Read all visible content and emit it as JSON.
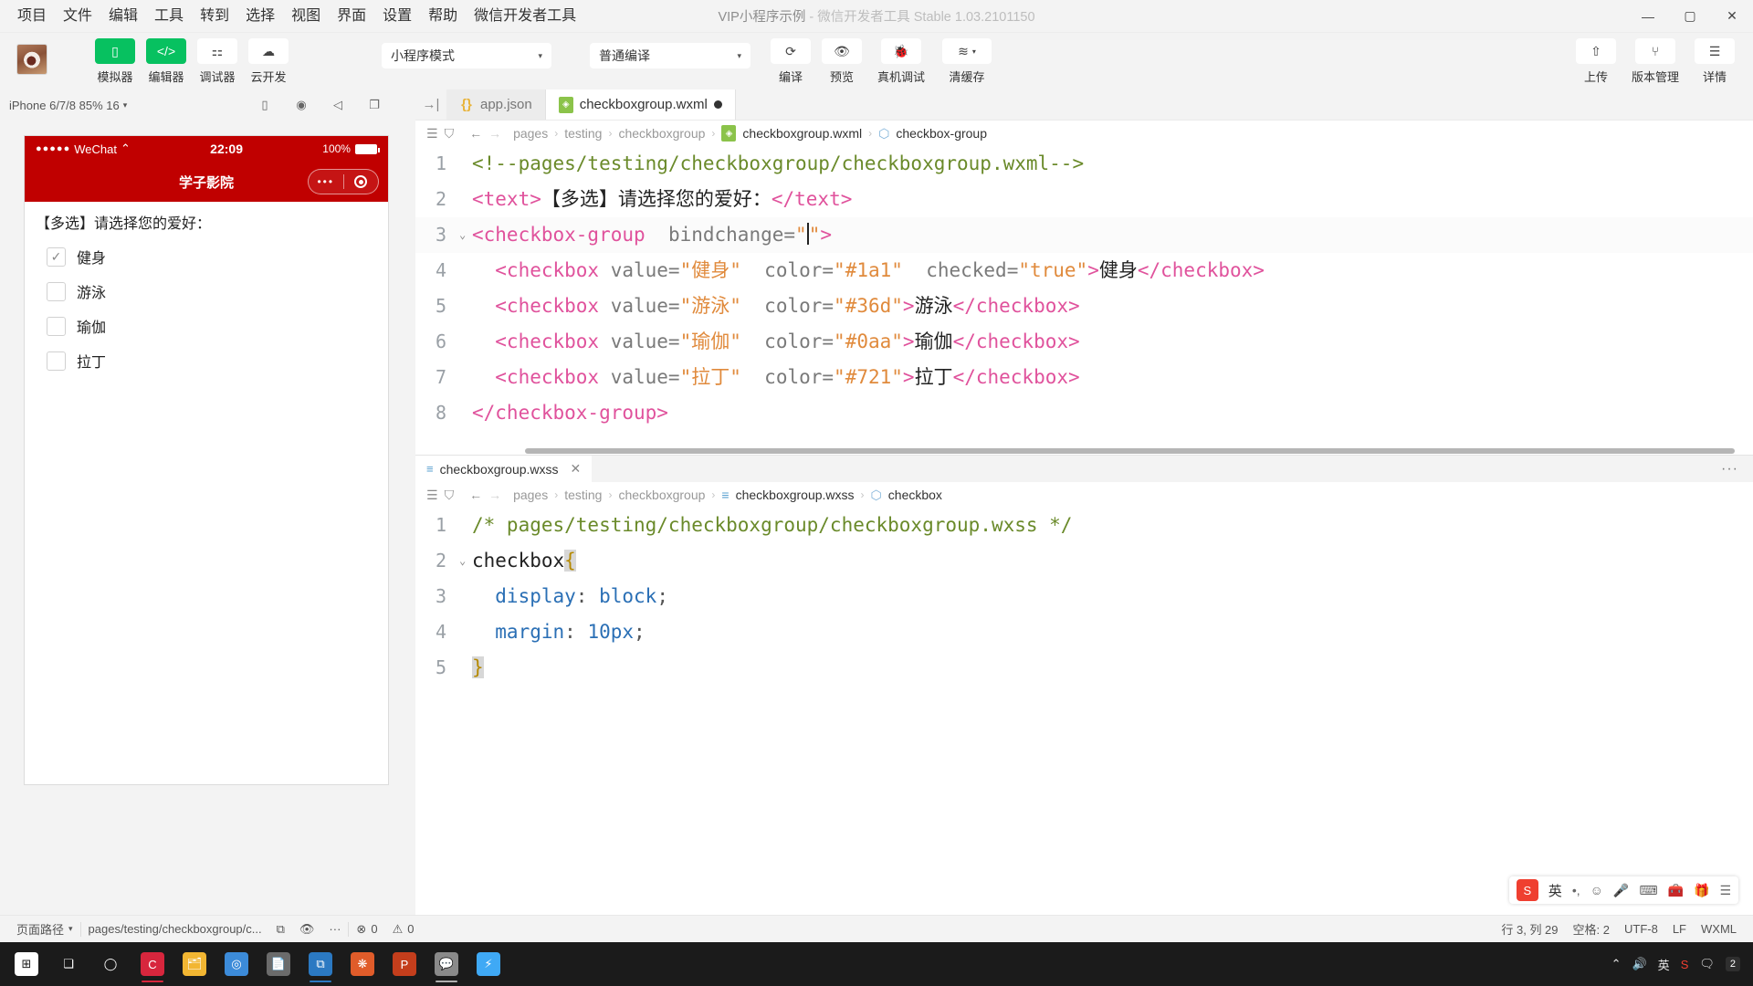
{
  "window": {
    "title_main": "VIP小程序示例",
    "title_sep": " - ",
    "title_sub": "微信开发者工具 Stable 1.03.2101150",
    "minimize": "—",
    "maximize": "▢",
    "close": "✕"
  },
  "menubar": {
    "items": [
      {
        "label": "项目"
      },
      {
        "label": "文件"
      },
      {
        "label": "编辑"
      },
      {
        "label": "工具"
      },
      {
        "label": "转到"
      },
      {
        "label": "选择"
      },
      {
        "label": "视图"
      },
      {
        "label": "界面"
      },
      {
        "label": "设置"
      },
      {
        "label": "帮助"
      },
      {
        "label": "微信开发者工具"
      }
    ]
  },
  "toolbar": {
    "panels": [
      {
        "label": "模拟器",
        "icon": "phone-icon",
        "glyph": "▯",
        "active": true
      },
      {
        "label": "编辑器",
        "icon": "code-icon",
        "glyph": "</>",
        "active": true
      },
      {
        "label": "调试器",
        "icon": "sliders-icon",
        "glyph": "⚏",
        "active": false
      },
      {
        "label": "云开发",
        "icon": "cloud-icon",
        "glyph": "☁",
        "active": false
      }
    ],
    "mode_select": {
      "value": "小程序模式",
      "caret": "▾"
    },
    "compile_select": {
      "value": "普通编译",
      "caret": "▾"
    },
    "actions": [
      {
        "label": "编译",
        "icon": "refresh-icon",
        "glyph": "⟳"
      },
      {
        "label": "预览",
        "icon": "eye-icon",
        "glyph": "👁"
      },
      {
        "label": "真机调试",
        "icon": "bug-icon",
        "glyph": "🐞"
      },
      {
        "label": "清缓存",
        "icon": "layers-icon",
        "glyph": "≋",
        "caret": "▾"
      }
    ],
    "right_actions": [
      {
        "label": "上传",
        "icon": "upload-icon",
        "glyph": "⇧"
      },
      {
        "label": "版本管理",
        "icon": "branch-icon",
        "glyph": "⑂"
      },
      {
        "label": "详情",
        "icon": "menu-icon",
        "glyph": "☰"
      }
    ]
  },
  "simulator": {
    "device_label": "iPhone 6/7/8 85% 16",
    "device_caret": "▾",
    "header_icons": [
      {
        "name": "device-frame-icon",
        "glyph": "▯"
      },
      {
        "name": "record-icon",
        "glyph": "◉"
      },
      {
        "name": "volume-icon",
        "glyph": "◁"
      },
      {
        "name": "window-icon",
        "glyph": "❐"
      }
    ],
    "phone": {
      "status": {
        "carrier_dots": "●●●●●",
        "carrier": "WeChat",
        "wifi": "⌃",
        "time": "22:09",
        "battery_pct": "100%"
      },
      "nav_title": "学子影院",
      "capsule_dots": "•••",
      "content_title": "【多选】请选择您的爱好：",
      "checkboxes": [
        {
          "label": "健身",
          "checked": true,
          "check_glyph": "✓"
        },
        {
          "label": "游泳",
          "checked": false,
          "check_glyph": ""
        },
        {
          "label": "瑜伽",
          "checked": false,
          "check_glyph": ""
        },
        {
          "label": "拉丁",
          "checked": false,
          "check_glyph": ""
        }
      ]
    }
  },
  "editor": {
    "tab_left_icon": "→|",
    "tabs": [
      {
        "label": "app.json",
        "icon": "json-file-icon",
        "icon_glyph": "{}",
        "active": false,
        "dirty": false
      },
      {
        "label": "checkboxgroup.wxml",
        "icon": "wxml-file-icon",
        "icon_glyph": "◈",
        "active": true,
        "dirty": true
      }
    ],
    "breadcrumb_top": {
      "icons": [
        {
          "name": "outline-icon",
          "glyph": "☰"
        },
        {
          "name": "bookmark-icon",
          "glyph": "⛉"
        },
        {
          "name": "back-arrow-icon",
          "glyph": "←"
        },
        {
          "name": "forward-arrow-icon",
          "glyph": "→"
        }
      ],
      "parts": [
        "pages",
        "testing",
        "checkboxgroup"
      ],
      "file": "checkboxgroup.wxml",
      "symbol": "checkbox-group",
      "separator": "›"
    },
    "wxml_lines": [
      {
        "n": 1,
        "fold": "",
        "tokens": [
          {
            "c": "t-comment",
            "t": "<!--pages/testing/checkboxgroup/checkboxgroup.wxml-->"
          }
        ]
      },
      {
        "n": 2,
        "fold": "",
        "tokens": [
          {
            "c": "t-tag",
            "t": "<text>"
          },
          {
            "c": "t-text",
            "t": "【多选】请选择您的爱好："
          },
          {
            "c": "t-tag",
            "t": "</text>"
          }
        ]
      },
      {
        "n": 3,
        "fold": "⌄",
        "highlight": true,
        "tokens": [
          {
            "c": "t-tag",
            "t": "<checkbox-group"
          },
          {
            "c": "t-attr",
            "t": "  bindchange="
          },
          {
            "c": "t-str",
            "t": "\""
          },
          {
            "c": "cursor",
            "t": ""
          },
          {
            "c": "t-str",
            "t": "\""
          },
          {
            "c": "t-tag",
            "t": ">"
          }
        ]
      },
      {
        "n": 4,
        "fold": "",
        "tokens": [
          {
            "c": "t-tag",
            "t": "  <checkbox"
          },
          {
            "c": "t-attr",
            "t": " value="
          },
          {
            "c": "t-str",
            "t": "\"健身\""
          },
          {
            "c": "t-attr",
            "t": "  color="
          },
          {
            "c": "t-str",
            "t": "\"#1a1\""
          },
          {
            "c": "t-attr",
            "t": "  checked="
          },
          {
            "c": "t-str",
            "t": "\"true\""
          },
          {
            "c": "t-tag",
            "t": ">"
          },
          {
            "c": "t-text",
            "t": "健身"
          },
          {
            "c": "t-tag",
            "t": "</checkbox>"
          }
        ]
      },
      {
        "n": 5,
        "fold": "",
        "tokens": [
          {
            "c": "t-tag",
            "t": "  <checkbox"
          },
          {
            "c": "t-attr",
            "t": " value="
          },
          {
            "c": "t-str",
            "t": "\"游泳\""
          },
          {
            "c": "t-attr",
            "t": "  color="
          },
          {
            "c": "t-str",
            "t": "\"#36d\""
          },
          {
            "c": "t-tag",
            "t": ">"
          },
          {
            "c": "t-text",
            "t": "游泳"
          },
          {
            "c": "t-tag",
            "t": "</checkbox>"
          }
        ]
      },
      {
        "n": 6,
        "fold": "",
        "tokens": [
          {
            "c": "t-tag",
            "t": "  <checkbox"
          },
          {
            "c": "t-attr",
            "t": " value="
          },
          {
            "c": "t-str",
            "t": "\"瑜伽\""
          },
          {
            "c": "t-attr",
            "t": "  color="
          },
          {
            "c": "t-str",
            "t": "\"#0aa\""
          },
          {
            "c": "t-tag",
            "t": ">"
          },
          {
            "c": "t-text",
            "t": "瑜伽"
          },
          {
            "c": "t-tag",
            "t": "</checkbox>"
          }
        ]
      },
      {
        "n": 7,
        "fold": "",
        "tokens": [
          {
            "c": "t-tag",
            "t": "  <checkbox"
          },
          {
            "c": "t-attr",
            "t": " value="
          },
          {
            "c": "t-str",
            "t": "\"拉丁\""
          },
          {
            "c": "t-attr",
            "t": "  color="
          },
          {
            "c": "t-str",
            "t": "\"#721\""
          },
          {
            "c": "t-tag",
            "t": ">"
          },
          {
            "c": "t-text",
            "t": "拉丁"
          },
          {
            "c": "t-tag",
            "t": "</checkbox>"
          }
        ]
      },
      {
        "n": 8,
        "fold": "",
        "tokens": [
          {
            "c": "t-tag",
            "t": "</checkbox-group>"
          }
        ]
      }
    ],
    "split": {
      "tab": {
        "label": "checkboxgroup.wxss",
        "icon_glyph": "≡",
        "close": "✕"
      },
      "more": "···",
      "breadcrumb": {
        "icons": [
          {
            "name": "outline-icon",
            "glyph": "☰"
          },
          {
            "name": "bookmark-icon",
            "glyph": "⛉"
          },
          {
            "name": "back-arrow-icon",
            "glyph": "←"
          },
          {
            "name": "forward-arrow-icon",
            "glyph": "→"
          }
        ],
        "parts": [
          "pages",
          "testing",
          "checkboxgroup"
        ],
        "file": "checkboxgroup.wxss",
        "symbol": "checkbox",
        "separator": "›"
      },
      "wxss_lines": [
        {
          "n": 1,
          "fold": "",
          "tokens": [
            {
              "c": "t-comment",
              "t": "/* pages/testing/checkboxgroup/checkboxgroup.wxss */"
            }
          ]
        },
        {
          "n": 2,
          "fold": "⌄",
          "tokens": [
            {
              "c": "t-css-sel",
              "t": "checkbox"
            },
            {
              "c": "sel-hl t-brace",
              "t": "{"
            }
          ]
        },
        {
          "n": 3,
          "fold": "",
          "tokens": [
            {
              "c": "t-css-prop",
              "t": "  display"
            },
            {
              "c": "t-punct",
              "t": ": "
            },
            {
              "c": "t-css-val",
              "t": "block"
            },
            {
              "c": "t-punct",
              "t": ";"
            }
          ]
        },
        {
          "n": 4,
          "fold": "",
          "tokens": [
            {
              "c": "t-css-prop",
              "t": "  margin"
            },
            {
              "c": "t-punct",
              "t": ": "
            },
            {
              "c": "t-css-val",
              "t": "10px"
            },
            {
              "c": "t-punct",
              "t": ";"
            }
          ]
        },
        {
          "n": 5,
          "fold": "",
          "tokens": [
            {
              "c": "sel-hl t-brace",
              "t": "}"
            }
          ]
        }
      ]
    }
  },
  "ime": {
    "logo": "S",
    "lang": "英",
    "items": [
      {
        "name": "ime-pinyin-icon",
        "glyph": "•,"
      },
      {
        "name": "ime-emoji-icon",
        "glyph": "☺"
      },
      {
        "name": "ime-mic-icon",
        "glyph": "🎤"
      },
      {
        "name": "ime-keyboard-icon",
        "glyph": "⌨"
      },
      {
        "name": "ime-toolbox-icon",
        "glyph": "🧰"
      },
      {
        "name": "ime-gift-icon",
        "glyph": "🎁"
      },
      {
        "name": "ime-menu-icon",
        "glyph": "☰"
      }
    ]
  },
  "statusbar": {
    "page_path_label": "页面路径",
    "page_path_caret": "▾",
    "path_value": "pages/testing/checkboxgroup/c...",
    "copy_icon": "⧉",
    "eye_icon": "👁",
    "more_icon": "···",
    "errors": {
      "icon": "⊗",
      "count": "0"
    },
    "warnings": {
      "icon": "⚠",
      "count": "0"
    },
    "cursor_pos": "行 3, 列 29",
    "spaces": "空格: 2",
    "encoding": "UTF-8",
    "eol": "LF",
    "language": "WXML"
  },
  "taskbar": {
    "items": [
      {
        "name": "start-button",
        "glyph": "⊞",
        "color": "#ffffff",
        "bg": "transparent",
        "underline": ""
      },
      {
        "name": "task-view-button",
        "glyph": "❏",
        "color": "#ffffff",
        "bg": "transparent",
        "underline": ""
      },
      {
        "name": "cortana-button",
        "glyph": "◯",
        "color": "#ffffff",
        "bg": "transparent",
        "underline": ""
      },
      {
        "name": "app-clementine",
        "glyph": "C",
        "color": "#ffffff",
        "bg": "#d7263d",
        "underline": "#d7263d"
      },
      {
        "name": "app-explorer",
        "glyph": "🗂",
        "color": "#ffffff",
        "bg": "#f2b632",
        "underline": ""
      },
      {
        "name": "app-chrome",
        "glyph": "◎",
        "color": "#ffffff",
        "bg": "#3c8bd9",
        "underline": ""
      },
      {
        "name": "app-notepad",
        "glyph": "📄",
        "color": "#ffffff",
        "bg": "#6b6b6b",
        "underline": ""
      },
      {
        "name": "app-vscode",
        "glyph": "⧉",
        "color": "#ffffff",
        "bg": "#2b79c2",
        "underline": "#2b79c2"
      },
      {
        "name": "app-xmind",
        "glyph": "❋",
        "color": "#ffffff",
        "bg": "#e05c2a",
        "underline": ""
      },
      {
        "name": "app-powerpoint",
        "glyph": "P",
        "color": "#ffffff",
        "bg": "#c43e1c",
        "underline": ""
      },
      {
        "name": "app-wechat-devtools",
        "glyph": "💬",
        "color": "#ffffff",
        "bg": "#6d6d6d",
        "underline": "#8a8a8a"
      },
      {
        "name": "app-thunder",
        "glyph": "⚡",
        "color": "#ffffff",
        "bg": "#3fa9f5",
        "underline": ""
      }
    ],
    "tray": {
      "chevron": "⌃",
      "volume": "🔊",
      "ime": "英",
      "sogou": "S",
      "notification": "🗨",
      "badge": "2"
    }
  }
}
